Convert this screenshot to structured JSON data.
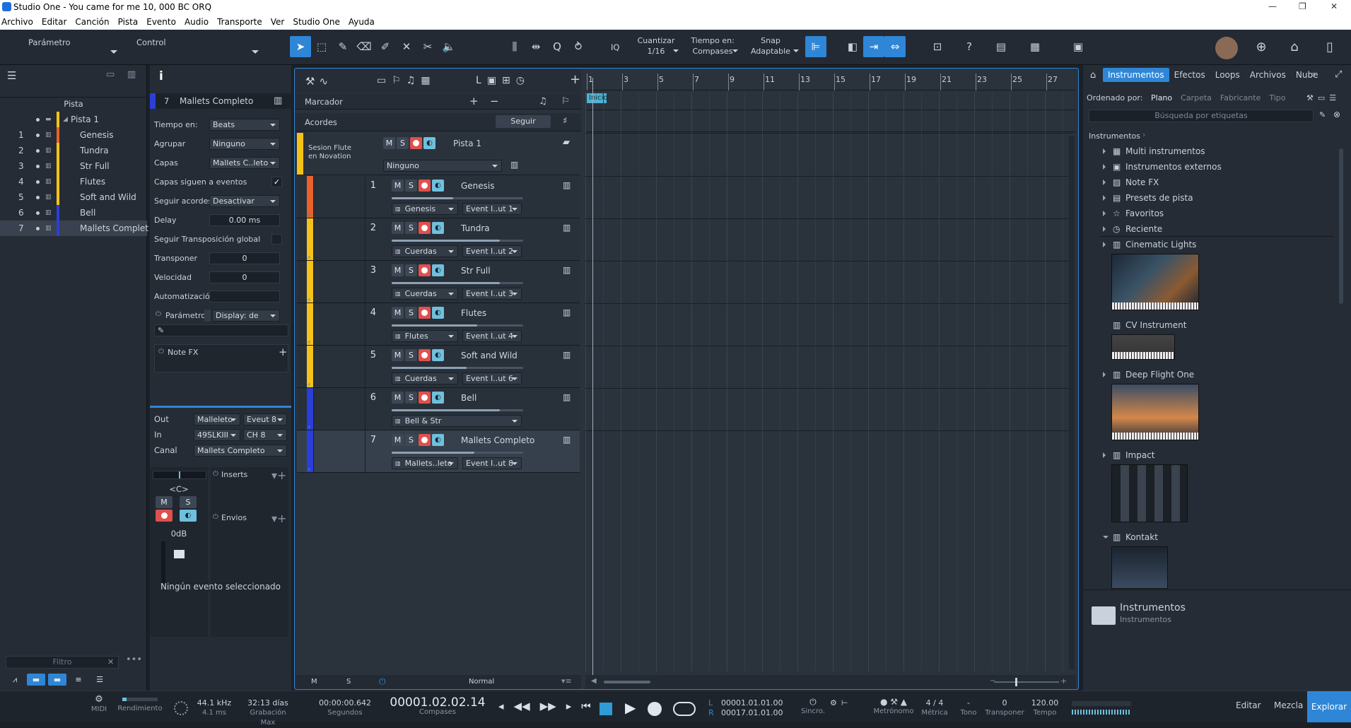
{
  "window": {
    "title": "Studio One - You came for me 10, 000 BC ORQ"
  },
  "menu": [
    "Archivo",
    "Editar",
    "Canción",
    "Pista",
    "Evento",
    "Audio",
    "Transporte",
    "Ver",
    "Studio One",
    "Ayuda"
  ],
  "toolbar": {
    "parametro": "Parámetro",
    "control": "Control",
    "iq": "IQ",
    "cuantizar_label": "Cuantizar",
    "cuantizar_value": "1/16",
    "tiempo_label": "Tiempo en:",
    "tiempo_value": "Compases",
    "snap_label": "Snap",
    "snap_value": "Adaptable"
  },
  "tracklist": {
    "header": "Pista",
    "folder": "Pista 1",
    "items": [
      {
        "num": "1",
        "name": "Genesis",
        "color": "#e8622a"
      },
      {
        "num": "2",
        "name": "Tundra",
        "color": "#f5c21a"
      },
      {
        "num": "3",
        "name": "Str Full",
        "color": "#f5c21a"
      },
      {
        "num": "4",
        "name": "Flutes",
        "color": "#f5c21a"
      },
      {
        "num": "5",
        "name": "Soft and Wild",
        "color": "#f5c21a"
      },
      {
        "num": "6",
        "name": "Bell",
        "color": "#2a3fd8"
      },
      {
        "num": "7",
        "name": "Mallets Complet",
        "color": "#2a3fd8"
      }
    ],
    "filter_placeholder": "Filtro"
  },
  "inspector": {
    "info": "i",
    "track_num": "7",
    "track_name": "Mallets Completo",
    "tiempo_label": "Tiempo en:",
    "tiempo_value": "Beats",
    "agrupar_label": "Agrupar",
    "agrupar_value": "Ninguno",
    "capas_label": "Capas",
    "capas_value": "Mallets C..leto",
    "capas_siguen": "Capas siguen a eventos",
    "seguir_acordes_label": "Seguir acordes",
    "seguir_acordes_value": "Desactivar",
    "delay_label": "Delay",
    "delay_value": "0.00 ms",
    "seguir_transp": "Seguir Transposición global",
    "transponer_label": "Transponer",
    "transponer_value": "0",
    "velocidad_label": "Velocidad",
    "velocidad_value": "0",
    "automatizacion_label": "Automatización",
    "parametro_label": "Parámetro",
    "display_value": "Display: de",
    "notefx": "Note FX",
    "out_label": "Out",
    "out_value": "Malleleto",
    "out_ch": "Eveut 8",
    "in_label": "In",
    "in_value": "49SLKIII",
    "in_ch": "CH 8",
    "canal_label": "Canal",
    "canal_value": "Mallets Completo",
    "pan": "<C>",
    "m": "M",
    "s": "S",
    "db": "0dB",
    "inserts": "Inserts",
    "envios": "Envios",
    "status": "Ningún evento seleccionado"
  },
  "arrange": {
    "marcador": "Marcador",
    "acordes": "Acordes",
    "seguir": "Seguir",
    "folder_name": "Pista 1",
    "folder_label": "Sesion Flute en Novation",
    "folder_select": "Ninguno",
    "inicio": "Inicio",
    "ruler": [
      "1",
      "3",
      "5",
      "7",
      "9",
      "11",
      "13",
      "15",
      "17",
      "19",
      "21",
      "23",
      "25",
      "27"
    ],
    "tracks": [
      {
        "num": "1",
        "name": "Genesis",
        "color": "#e8622a",
        "vol": 0.47,
        "s1": "Genesis",
        "s2": "Event I..ut 1"
      },
      {
        "num": "2",
        "name": "Tundra",
        "color": "#f5c21a",
        "vol": 0.82,
        "s1": "Cuerdas",
        "s2": "Event I..ut 2"
      },
      {
        "num": "3",
        "name": "Str Full",
        "color": "#f5c21a",
        "vol": 0.82,
        "s1": "Cuerdas",
        "s2": "Event I..ut 3"
      },
      {
        "num": "4",
        "name": "Flutes",
        "color": "#f5c21a",
        "vol": 0.65,
        "s1": "Flutes",
        "s2": "Event I..ut 4"
      },
      {
        "num": "5",
        "name": "Soft and Wild",
        "color": "#f5c21a",
        "vol": 0.57,
        "s1": "Cuerdas",
        "s2": "Event I..ut 6"
      },
      {
        "num": "6",
        "name": "Bell",
        "color": "#2a3fd8",
        "vol": 0.82,
        "s1": "Bell & Str",
        "s2": ""
      },
      {
        "num": "7",
        "name": "Mallets Completo",
        "color": "#2a3fd8",
        "vol": 0.63,
        "s1": "Mallets..leto",
        "s2": "Event I..ut 8"
      }
    ],
    "bottom_m": "M",
    "bottom_s": "S",
    "bottom_mode": "Normal"
  },
  "browser": {
    "tabs": [
      "Instrumentos",
      "Efectos",
      "Loops",
      "Archivos",
      "Nube"
    ],
    "ordenado": "Ordenado por:",
    "sort": [
      "Plano",
      "Carpeta",
      "Fabricante",
      "Tipo"
    ],
    "search_placeholder": "Búsqueda por etiquetas",
    "crumb": "Instrumentos",
    "items": [
      "Multi instrumentos",
      "Instrumentos externos",
      "Note FX",
      "Presets de pista",
      "Favoritos",
      "Reciente"
    ],
    "plugins": [
      "Cinematic Lights",
      "CV Instrument",
      "Deep Flight One",
      "Impact",
      "Kontakt"
    ],
    "footer_title": "Instrumentos",
    "footer_sub": "Instrumentos"
  },
  "transport": {
    "midi": "MIDI",
    "rendimiento": "Rendimiento",
    "khz": "44.1 kHz",
    "ms": "4.1 ms",
    "dias": "32:13 días",
    "grab": "Grabación Max",
    "seg_val": "00:00:00.642",
    "seg_lbl": "Segundos",
    "pos": "00001.02.02.14",
    "compases": "Compases",
    "l": "L",
    "r": "R",
    "loop_l": "00001.01.01.00",
    "loop_r": "00017.01.01.00",
    "sincro": "Sincro.",
    "metronomo": "Metrónomo",
    "metrica_val": "4 / 4",
    "metrica": "Métrica",
    "tono_val": "-",
    "tono": "Tono",
    "transp_val": "0",
    "transponer": "Transponer",
    "tempo_val": "120.00",
    "tempo": "Tempo",
    "editar": "Editar",
    "mezcla": "Mezcla",
    "explorar": "Explorar"
  }
}
